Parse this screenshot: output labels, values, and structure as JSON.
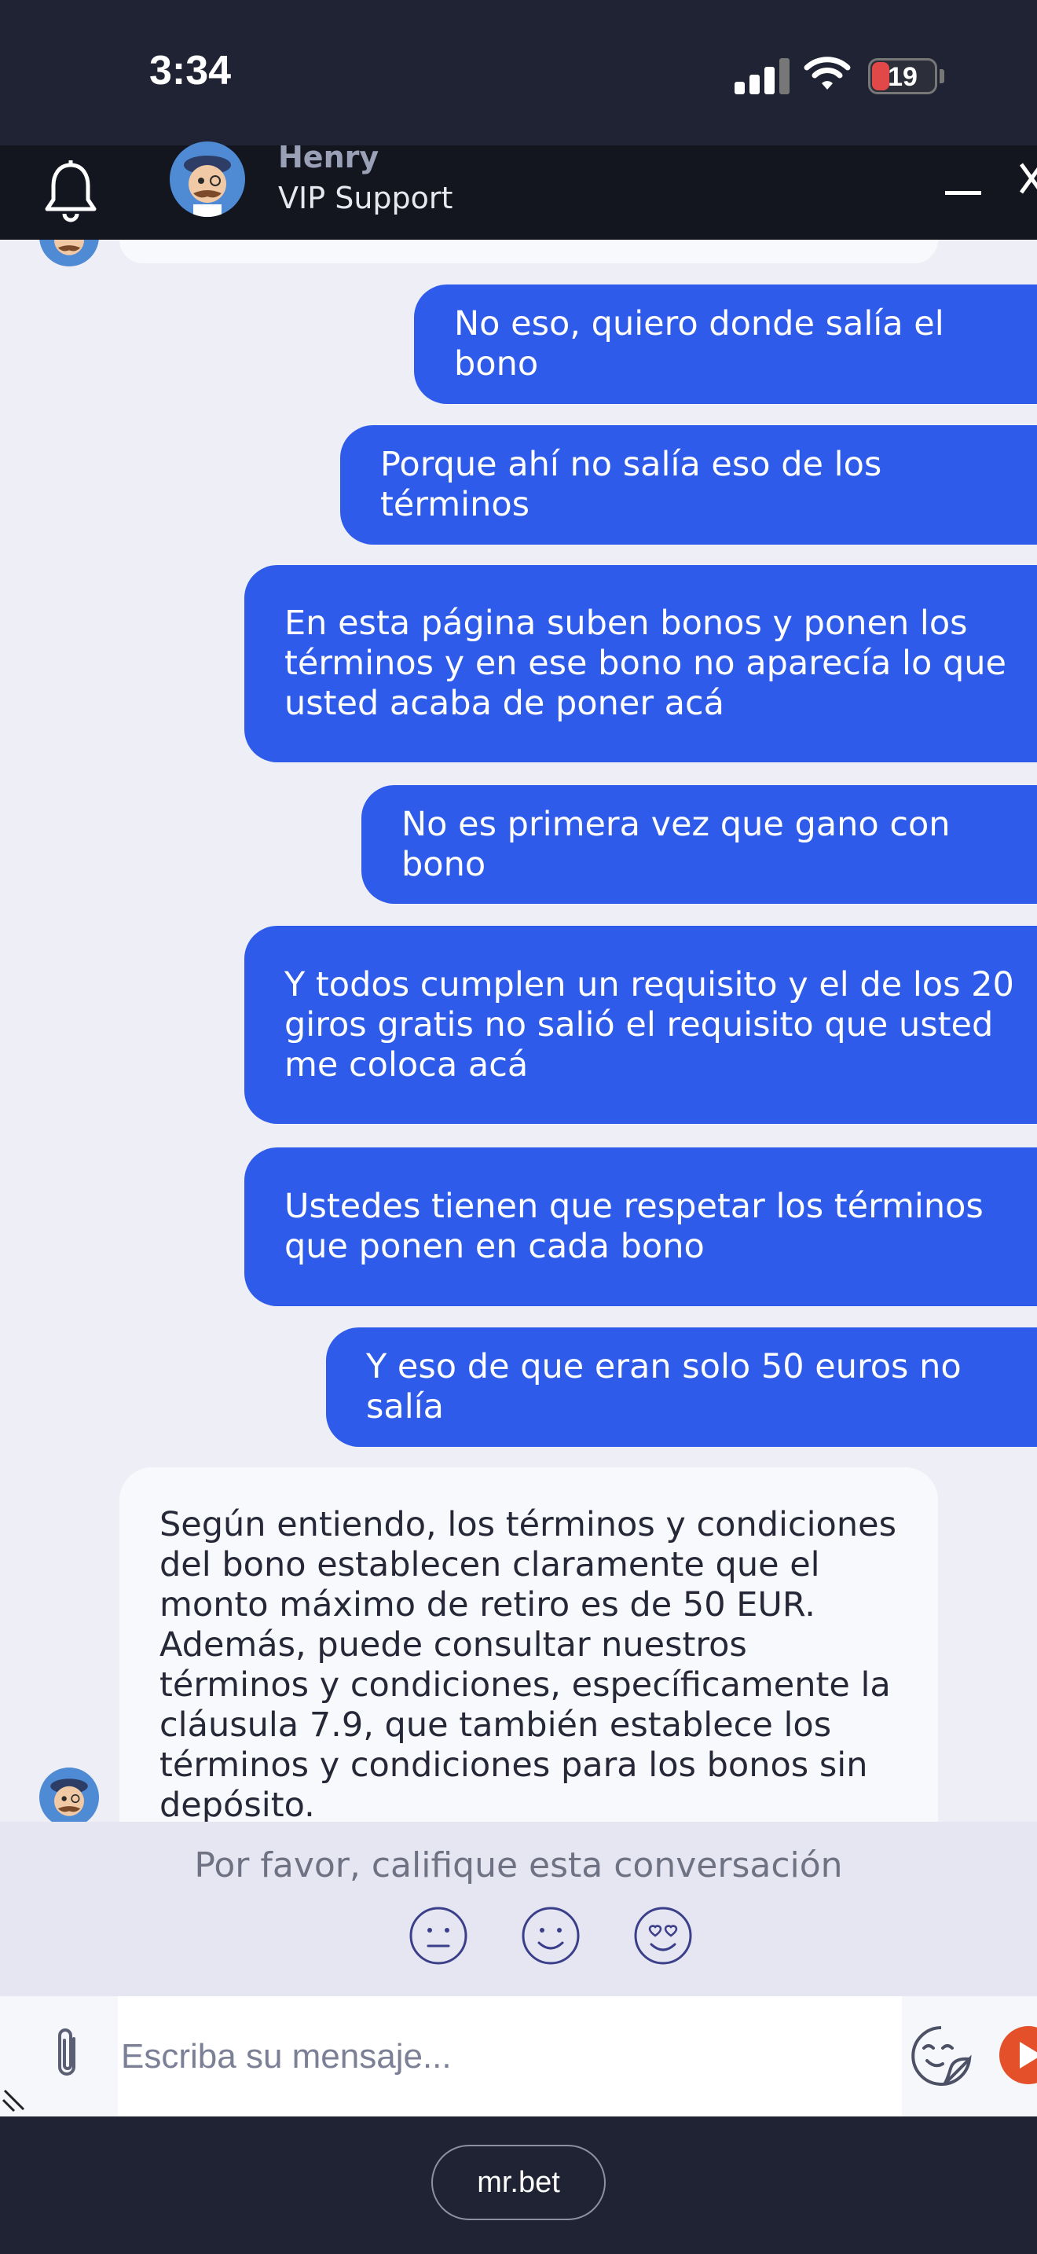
{
  "status_bar": {
    "time": "3:34",
    "battery": "19"
  },
  "header": {
    "agent_name": "Henry",
    "agent_role": "VIP Support"
  },
  "messages": [
    {
      "from": "user",
      "text": "No eso, quiero donde salía el bono"
    },
    {
      "from": "user",
      "text": "Porque ahí no salía eso de los términos"
    },
    {
      "from": "user",
      "text": "En esta página suben bonos y ponen los términos y en ese bono no aparecía lo que usted acaba de poner acá"
    },
    {
      "from": "user",
      "text": "No es primera vez que gano con bono"
    },
    {
      "from": "user",
      "text": "Y todos cumplen un requisito y el de los 20 giros gratis no salió el requisito que usted me coloca acá"
    },
    {
      "from": "user",
      "text": "Ustedes tienen que respetar los términos que ponen en cada bono"
    },
    {
      "from": "user",
      "text": "Y eso de que eran solo 50 euros no salía"
    },
    {
      "from": "agent",
      "text": "Según entiendo, los términos y condiciones del bono establecen claramente que el monto máximo de retiro es de 50 EUR. Además, puede consultar nuestros términos y condiciones, específicamente la cláusula 7.9, que también establece los términos y condiciones para los bonos sin depósito."
    }
  ],
  "rating": {
    "prompt": "Por favor, califique esta conversación",
    "options": [
      "neutral-face-icon",
      "smile-face-icon",
      "heart-eyes-face-icon"
    ]
  },
  "composer": {
    "placeholder": "Escriba su mensaje..."
  },
  "browser": {
    "url": "mr.bet"
  },
  "colors": {
    "user_bubble": "#2f5bea",
    "agent_bubble": "#f8f9fc",
    "send_button": "#e4502a"
  }
}
